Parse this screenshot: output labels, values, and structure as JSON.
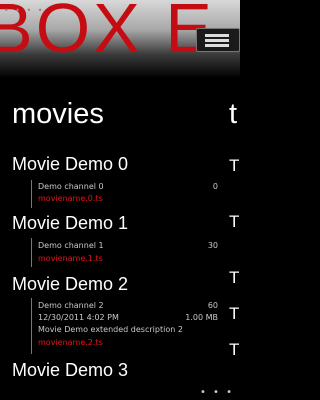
{
  "status": {
    "time": "",
    "dots": "• • • •"
  },
  "banner": {
    "text": "BOX E"
  },
  "page": {
    "title": "movies",
    "next_title": "t"
  },
  "peek_letters": [
    "T",
    "T",
    "T",
    "T",
    "T"
  ],
  "movies": [
    {
      "title": "Movie Demo 0",
      "channel": "Demo channel 0",
      "channel_num": "0",
      "file": "moviename.0.ts"
    },
    {
      "title": "Movie Demo 1",
      "channel": "Demo channel 1",
      "channel_num": "30",
      "file": "moviename.1.ts"
    },
    {
      "title": "Movie Demo 2",
      "channel": "Demo channel 2",
      "channel_num": "60",
      "datetime": "12/30/2011 4:02 PM",
      "size": "1.00 MB",
      "description": "Movie Demo extended description 2",
      "file": "moviename.2.ts"
    },
    {
      "title": "Movie Demo 3"
    }
  ],
  "appbar": {
    "more_label": "• • •"
  },
  "colors": {
    "accent": "#e2141c",
    "banner_red": "#c40d12",
    "background": "#000000"
  }
}
